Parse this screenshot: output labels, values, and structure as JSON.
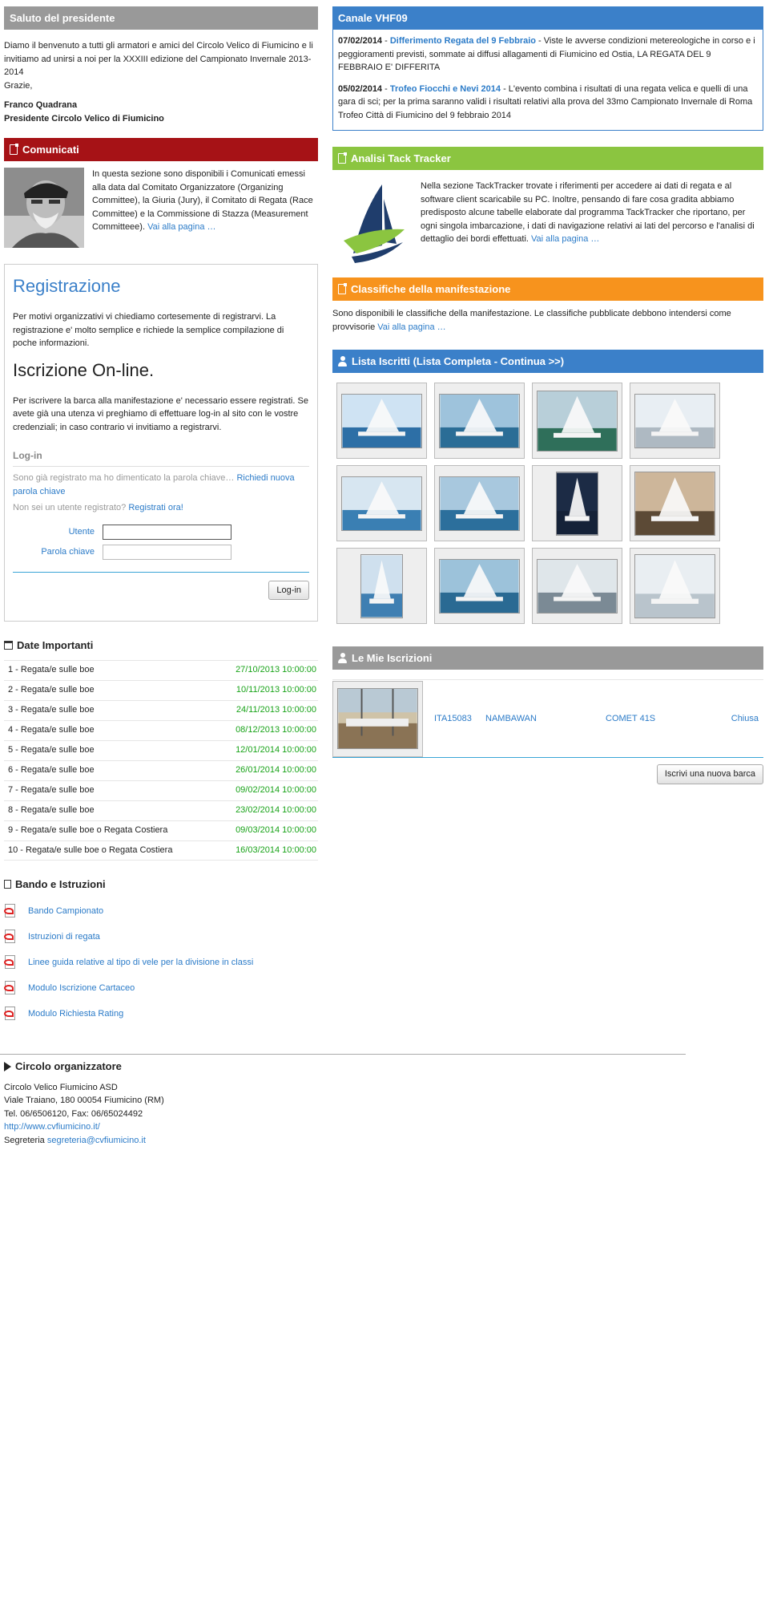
{
  "president": {
    "title": "Saluto del presidente",
    "body": "Diamo il benvenuto a tutti gli armatori e amici del Circolo Velico di Fiumicino e li invitiamo ad unirsi a noi per la XXXIII edizione del Campionato Invernale 2013-2014",
    "thanks": "Grazie,",
    "name": "Franco Quadrana",
    "role": "Presidente Circolo Velico di Fiumicino"
  },
  "comunicati": {
    "title": "Comunicati",
    "body": "In questa sezione sono disponibili i Comunicati emessi alla data dal Comitato Organizzatore (Organizing Committee), la Giuria (Jury), il Comitato di Regata (Race Committee) e la Commissione di Stazza (Measurement Committeee).",
    "link": "Vai alla pagina …"
  },
  "registration": {
    "title": "Registrazione",
    "intro": "Per motivi organizzativi vi chiediamo cortesemente di registrarvi. La registrazione e' molto semplice e richiede la semplice compilazione di poche informazioni.",
    "subtitle": "Iscrizione On-line.",
    "body": "Per iscrivere la barca alla manifestazione e' necessario essere registrati. Se avete già una utenza vi preghiamo di effettuare log-in al sito con le vostre credenziali; in caso contrario vi invitiamo a registrarvi.",
    "login_title": "Log-in",
    "forgot_text": "Sono già registrato ma ho dimenticato la parola chiave…",
    "forgot_link": "Richiedi nuova parola chiave",
    "not_registered_text": "Non sei un utente registrato?",
    "register_link": "Registrati ora!",
    "user_label": "Utente",
    "password_label": "Parola chiave",
    "login_button": "Log-in"
  },
  "dates": {
    "title": "Date Importanti",
    "items": [
      {
        "label": "1 - Regata/e sulle boe",
        "date": "27/10/2013 10:00:00"
      },
      {
        "label": "2 - Regata/e sulle boe",
        "date": "10/11/2013 10:00:00"
      },
      {
        "label": "3 - Regata/e sulle boe",
        "date": "24/11/2013 10:00:00"
      },
      {
        "label": "4 - Regata/e sulle boe",
        "date": "08/12/2013 10:00:00"
      },
      {
        "label": "5 - Regata/e sulle boe",
        "date": "12/01/2014 10:00:00"
      },
      {
        "label": "6 - Regata/e sulle boe",
        "date": "26/01/2014 10:00:00"
      },
      {
        "label": "7 - Regata/e sulle boe",
        "date": "09/02/2014 10:00:00"
      },
      {
        "label": "8 - Regata/e sulle boe",
        "date": "23/02/2014 10:00:00"
      },
      {
        "label": "9 - Regata/e sulle boe o Regata Costiera",
        "date": "09/03/2014 10:00:00"
      },
      {
        "label": "10 - Regata/e sulle boe o Regata Costiera",
        "date": "16/03/2014 10:00:00"
      }
    ]
  },
  "documents": {
    "title": "Bando e Istruzioni",
    "items": [
      {
        "label": "Bando Campionato"
      },
      {
        "label": "Istruzioni di regata"
      },
      {
        "label": "Linee guida relative al tipo di vele per la divisione in classi"
      },
      {
        "label": "Modulo Iscrizione Cartaceo"
      },
      {
        "label": "Modulo Richiesta Rating"
      }
    ]
  },
  "vhf": {
    "title": "Canale VHF09",
    "items": [
      {
        "date": "07/02/2014",
        "sep": " - ",
        "link": "Differimento Regata del 9 Febbraio",
        "text": " - Viste le avverse condizioni metereologiche in corso e i peggioramenti previsti, sommate ai diffusi allagamenti di Fiumicino ed Ostia, LA REGATA DEL 9 FEBBRAIO E' DIFFERITA"
      },
      {
        "date": "05/02/2014",
        "sep": " - ",
        "link": "Trofeo Fiocchi e Nevi 2014",
        "text": " - L'evento combina i risultati di una regata velica e quelli di una gara di sci; per la prima saranno validi i risultati relativi alla prova del 33mo Campionato Invernale di Roma Trofeo Città di Fiumicino del 9 febbraio 2014"
      }
    ]
  },
  "tacktracker": {
    "title": "Analisi Tack Tracker",
    "body": "Nella sezione TackTracker trovate i riferimenti per accedere ai dati di regata e al software client scaricabile su PC. Inoltre, pensando di fare cosa gradita abbiamo predisposto alcune tabelle elaborate dal programma TackTracker che riportano, per ogni singola imbarcazione, i dati di navigazione relativi ai lati del percorso e l'analisi di dettaglio dei bordi effettuati.",
    "link": "Vai alla pagina …"
  },
  "classifiche": {
    "title": "Classifiche della manifestazione",
    "body": "Sono disponibili le classifiche della manifestazione. Le classifiche pubblicate debbono intendersi come provvisorie",
    "link": "Vai alla pagina …"
  },
  "iscritti": {
    "title": "Lista Iscritti (Lista Completa - Continua >>)"
  },
  "mie_iscrizioni": {
    "title": "Le Mie Iscrizioni",
    "row": {
      "sail": "ITA15083",
      "name": "NAMBAWAN",
      "model": "COMET 41S",
      "status": "Chiusa"
    },
    "new_button": "Iscrivi una nuova barca"
  },
  "footer": {
    "title": "Circolo organizzatore",
    "org": "Circolo Velico Fiumicino ASD",
    "address": "Viale Traiano, 180 00054 Fiumicino (RM)",
    "phone": "Tel. 06/6506120, Fax: 06/65024492",
    "website": "http://www.cvfiumicino.it/",
    "email_label": "Segreteria",
    "email": "segreteria@cvfiumicino.it"
  }
}
